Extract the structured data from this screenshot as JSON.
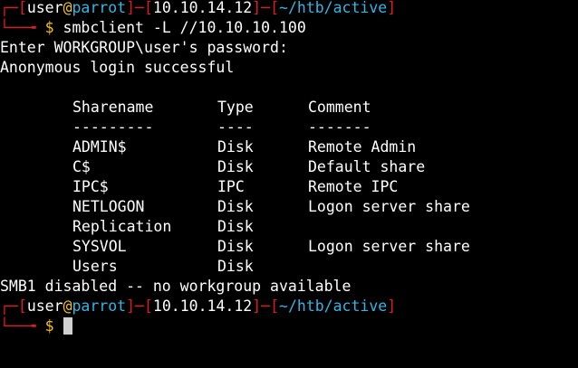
{
  "prompt1": {
    "corner_top": "┌─[",
    "user": "user",
    "at": "@",
    "host": "parrot",
    "sep1": "]─[",
    "ip": "10.10.14.12",
    "sep2": "]─[",
    "path": "~/htb/active",
    "close": "]",
    "corner_bottom": "└──╼ ",
    "dollar": "$",
    "command": " smbclient -L //10.10.10.100"
  },
  "output": {
    "password_prompt": "Enter WORKGROUP\\user's password:",
    "login_result": "Anonymous login successful",
    "footer": "SMB1 disabled -- no workgroup available"
  },
  "share_table": {
    "headers": [
      "Sharename",
      "Type",
      "Comment"
    ],
    "separators": [
      "---------",
      "----",
      "-------"
    ],
    "rows": [
      [
        "ADMIN$",
        "Disk",
        "Remote Admin"
      ],
      [
        "C$",
        "Disk",
        "Default share"
      ],
      [
        "IPC$",
        "IPC",
        "Remote IPC"
      ],
      [
        "NETLOGON",
        "Disk",
        "Logon server share"
      ],
      [
        "Replication",
        "Disk",
        ""
      ],
      [
        "SYSVOL",
        "Disk",
        "Logon server share"
      ],
      [
        "Users",
        "Disk",
        ""
      ]
    ]
  },
  "prompt2": {
    "corner_top": "┌─[",
    "user": "user",
    "at": "@",
    "host": "parrot",
    "sep1": "]─[",
    "ip": "10.10.14.12",
    "sep2": "]─[",
    "path": "~/htb/active",
    "close": "]",
    "corner_bottom": "└──╼ ",
    "dollar": "$"
  },
  "colors": {
    "background": "#000000",
    "prompt_frame": "#e01b24",
    "dollar": "#f5c211",
    "hostname": "#33b5e5",
    "text": "#ffffff"
  }
}
